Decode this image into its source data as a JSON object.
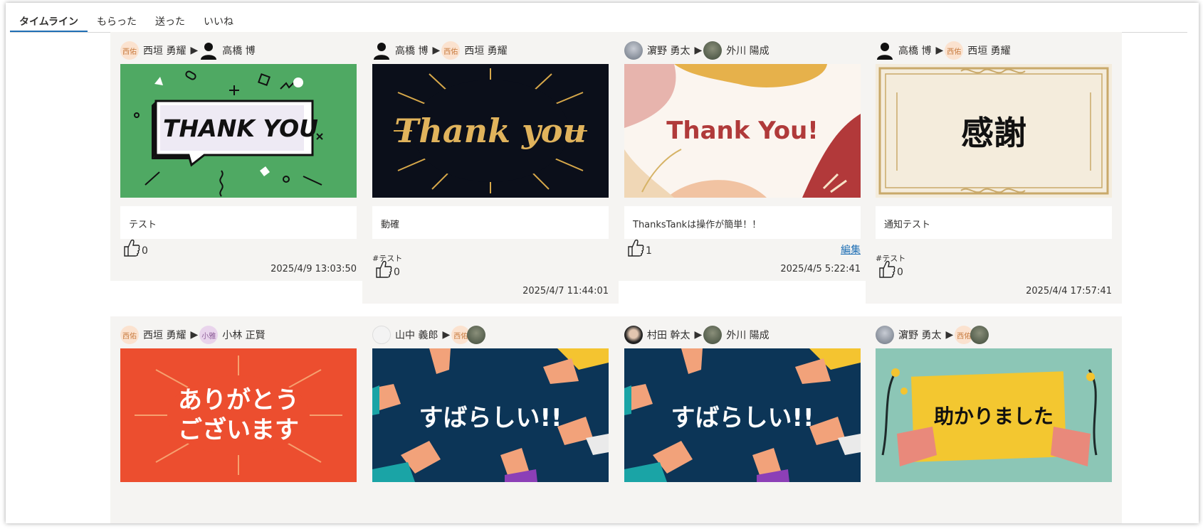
{
  "tabs": [
    {
      "label": "タイムライン",
      "active": true
    },
    {
      "label": "もらった",
      "active": false
    },
    {
      "label": "送った",
      "active": false
    },
    {
      "label": "いいね",
      "active": false
    }
  ],
  "colors": {
    "accent": "#1f6fb5",
    "card_bg": "#f5f4f2"
  },
  "cards": [
    {
      "from": {
        "name": "西垣 勇耀",
        "avatar_text": "西佑"
      },
      "to": {
        "name": "高橋 博"
      },
      "image_text": "THANK YOU",
      "message": "テスト",
      "likes": "0",
      "timestamp": "2025/4/9 13:03:50"
    },
    {
      "from": {
        "name": "高橋 博"
      },
      "to": {
        "name": "西垣 勇耀",
        "avatar_text": "西佑"
      },
      "image_text": "Thank you",
      "message": "動確",
      "hashtag": "#テスト",
      "likes": "0",
      "timestamp": "2025/4/7 11:44:01"
    },
    {
      "from": {
        "name": "濵野 勇太"
      },
      "to": {
        "name": "外川 陽成"
      },
      "image_text": "Thank You!",
      "message": "ThanksTankは操作が簡単！！",
      "likes": "1",
      "edit_label": "編集",
      "timestamp": "2025/4/5 5:22:41"
    },
    {
      "from": {
        "name": "高橋 博"
      },
      "to": {
        "name": "西垣 勇耀",
        "avatar_text": "西佑"
      },
      "image_text": "感謝",
      "message": "通知テスト",
      "hashtag": "#テスト",
      "likes": "0",
      "timestamp": "2025/4/4 17:57:41"
    },
    {
      "from": {
        "name": "西垣 勇耀",
        "avatar_text": "西佑"
      },
      "to": {
        "name": "小林 正賢",
        "avatar_text": "小雅"
      },
      "image_text_line1": "ありがとう",
      "image_text_line2": "ございます"
    },
    {
      "from": {
        "name": "山中 義郎"
      },
      "to": {
        "avatar_text": "西佑"
      },
      "image_text": "すばらしい!!"
    },
    {
      "from": {
        "name": "村田 幹太"
      },
      "to": {
        "name": "外川 陽成"
      },
      "image_text": "すばらしい!!"
    },
    {
      "from": {
        "name": "濵野 勇太"
      },
      "to": {
        "avatar_text": "西佑"
      },
      "image_text": "助かりました"
    }
  ]
}
